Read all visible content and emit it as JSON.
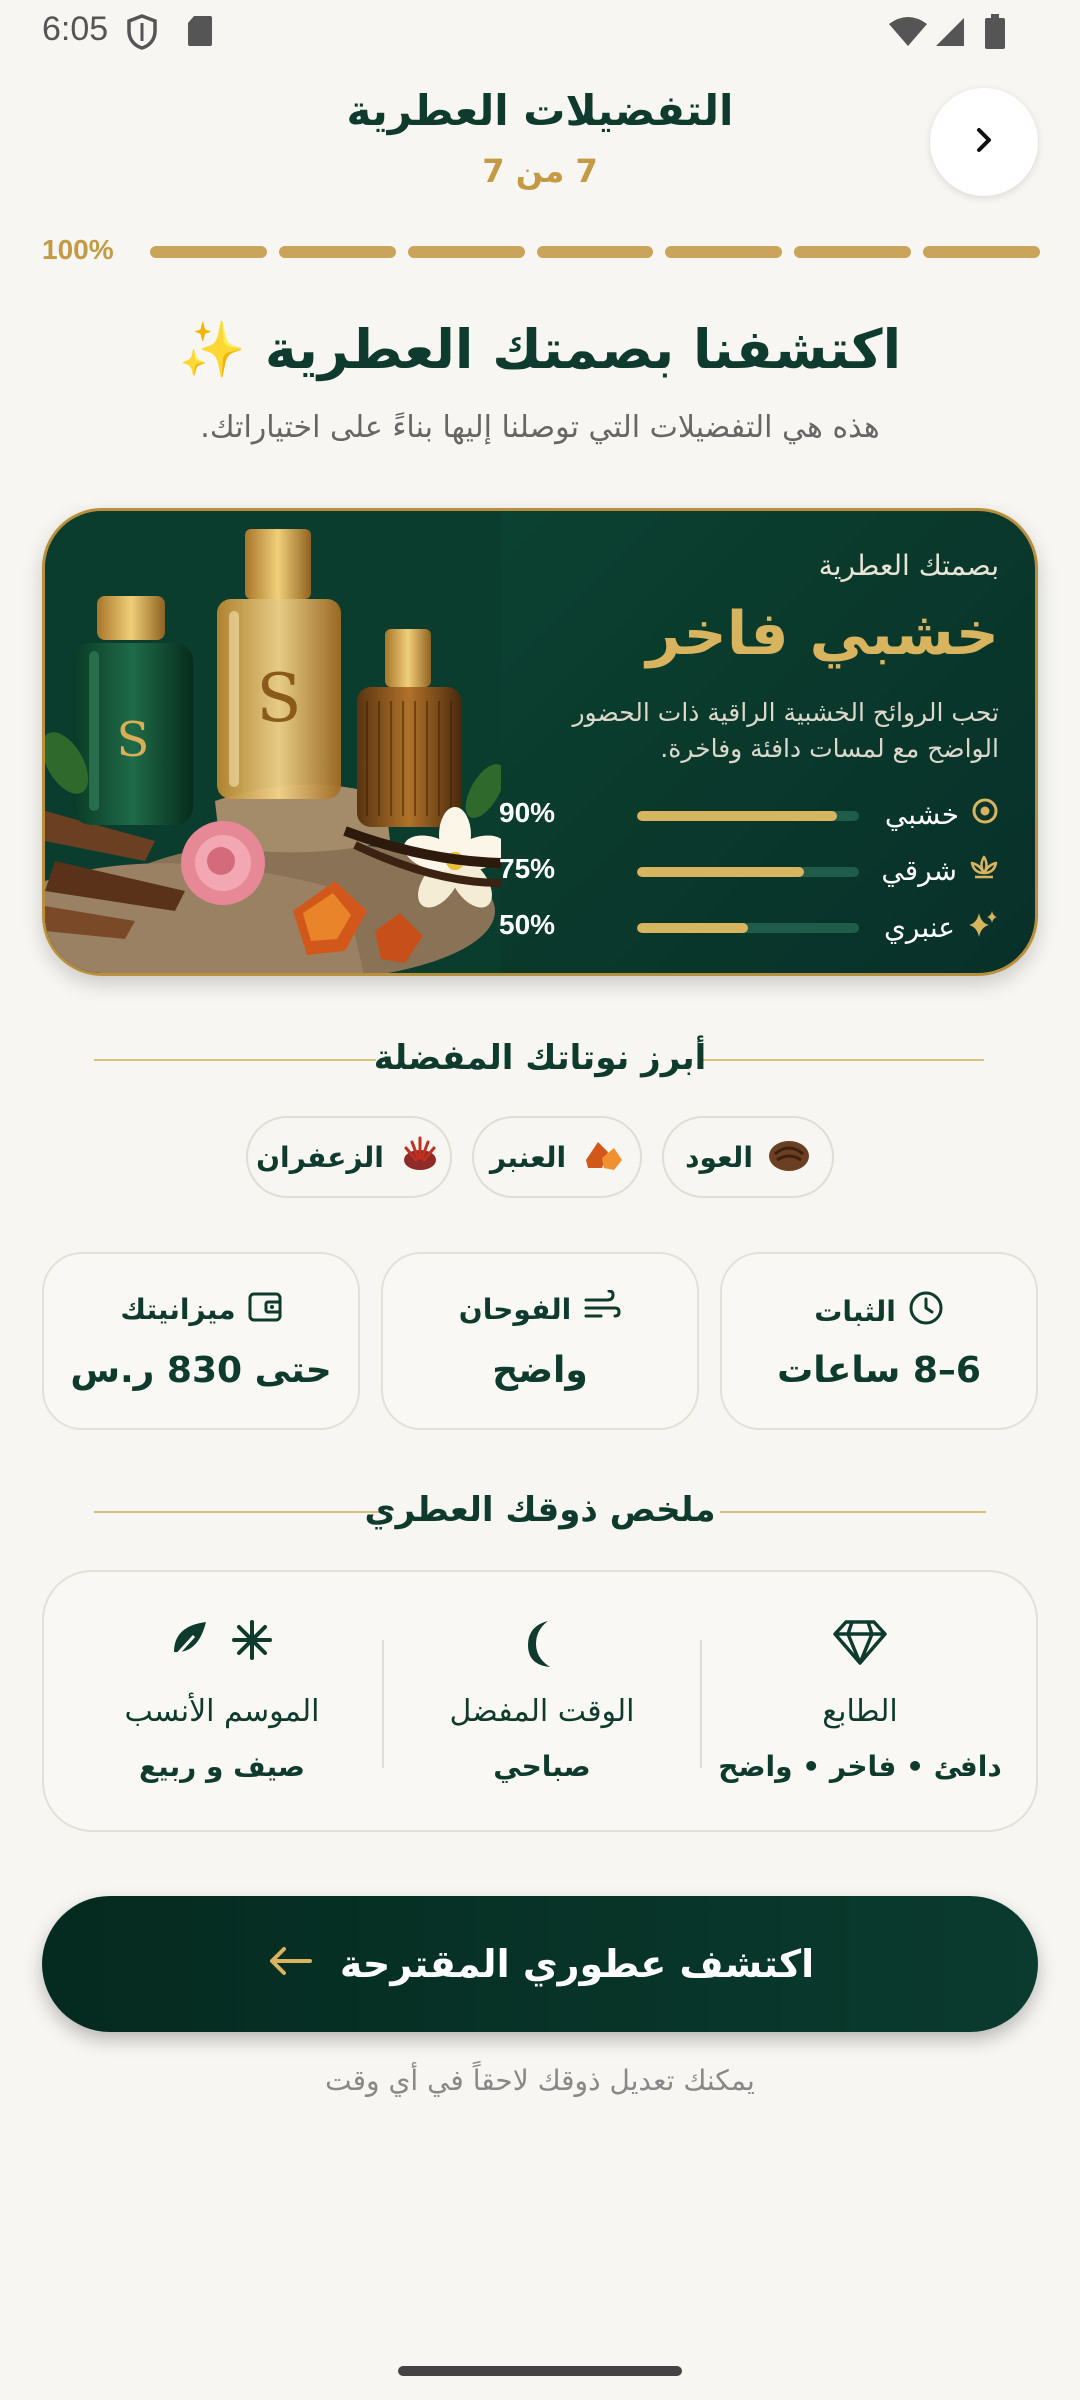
{
  "status_bar": {
    "time": "6:05"
  },
  "header": {
    "title": "التفضيلات العطرية",
    "step": "7 من 7"
  },
  "progress": {
    "label": "100%",
    "segments": 7,
    "completed": 7,
    "fraction": 1.0
  },
  "intro": {
    "heading": "اكتشفنا بصمتك العطرية ✨",
    "subheading": "هذه هي التفضيلات التي توصلنا إليها بناءً على اختياراتك."
  },
  "hero": {
    "label": "بصمتك العطرية",
    "title": "خشبي فاخر",
    "description": "تحب الروائح الخشبية الراقية ذات الحضور الواضح مع لمسات دافئة وفاخرة.",
    "notes": [
      {
        "name": "خشبي",
        "percent": "90%",
        "value": 0.9,
        "icon": "target-icon"
      },
      {
        "name": "شرقي",
        "percent": "75%",
        "value": 0.75,
        "icon": "lotus-icon"
      },
      {
        "name": "عنبري",
        "percent": "50%",
        "value": 0.5,
        "icon": "sparkle-icon"
      }
    ],
    "accent": "#d8b45e",
    "background": "#0d4a38"
  },
  "top_notes": {
    "title": "أبرز نوتاتك المفضلة",
    "items": [
      {
        "label": "العود",
        "icon": "oud-icon"
      },
      {
        "label": "العنبر",
        "icon": "amber-icon"
      },
      {
        "label": "الزعفران",
        "icon": "saffron-icon"
      }
    ]
  },
  "stats": [
    {
      "label": "الثبات",
      "value": "6–8 ساعات",
      "icon": "clock-icon"
    },
    {
      "label": "الفوحان",
      "value": "واضح",
      "icon": "wind-icon"
    },
    {
      "label": "ميزانيتك",
      "value": "حتى 830 ر.س",
      "icon": "wallet-icon"
    }
  ],
  "summary": {
    "title": "ملخص ذوقك العطري",
    "items": [
      {
        "label": "الطابع",
        "value": "دافئ • فاخر • واضح",
        "icon": "diamond-icon"
      },
      {
        "label": "الوقت المفضل",
        "value": "صباحي",
        "icon": "moon-icon"
      },
      {
        "label": "الموسم الأنسب",
        "value": "صيف و ربيع",
        "icon": "leaf-snowflake-icon"
      }
    ]
  },
  "cta": {
    "label": "اكتشف عطوري المقترحة"
  },
  "footer": {
    "note": "يمكنك تعديل ذوقك لاحقاً في أي وقت"
  }
}
